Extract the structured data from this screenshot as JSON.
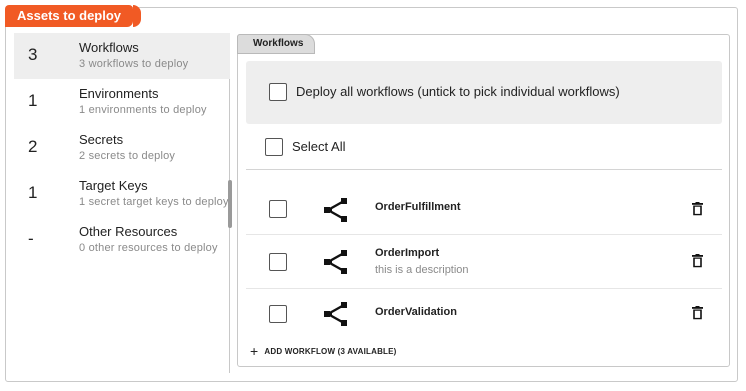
{
  "header": {
    "title": "Assets to deploy"
  },
  "sidebar": {
    "items": [
      {
        "count": "3",
        "title": "Workflows",
        "subtitle": "3 workflows to deploy"
      },
      {
        "count": "1",
        "title": "Environments",
        "subtitle": "1 environments to deploy"
      },
      {
        "count": "2",
        "title": "Secrets",
        "subtitle": "2 secrets to deploy"
      },
      {
        "count": "1",
        "title": "Target Keys",
        "subtitle": "1 secret target keys to deploy"
      },
      {
        "count": "-",
        "title": "Other Resources",
        "subtitle": "0 other resources to deploy"
      }
    ]
  },
  "main": {
    "tab_label": "Workflows",
    "deploy_all_label": "Deploy all workflows (untick to pick individual workflows)",
    "select_all_label": "Select All",
    "workflows": [
      {
        "name": "OrderFulfillment",
        "description": ""
      },
      {
        "name": "OrderImport",
        "description": "this is a description"
      },
      {
        "name": "OrderValidation",
        "description": ""
      }
    ],
    "add_workflow_label": "ADD WORKFLOW (3 AVAILABLE)"
  },
  "colors": {
    "accent": "#f15a24",
    "active_bg": "#eeeeee"
  },
  "icons": {
    "workflow": "workflow-graph-icon",
    "delete": "trash-icon",
    "add": "plus-icon"
  }
}
